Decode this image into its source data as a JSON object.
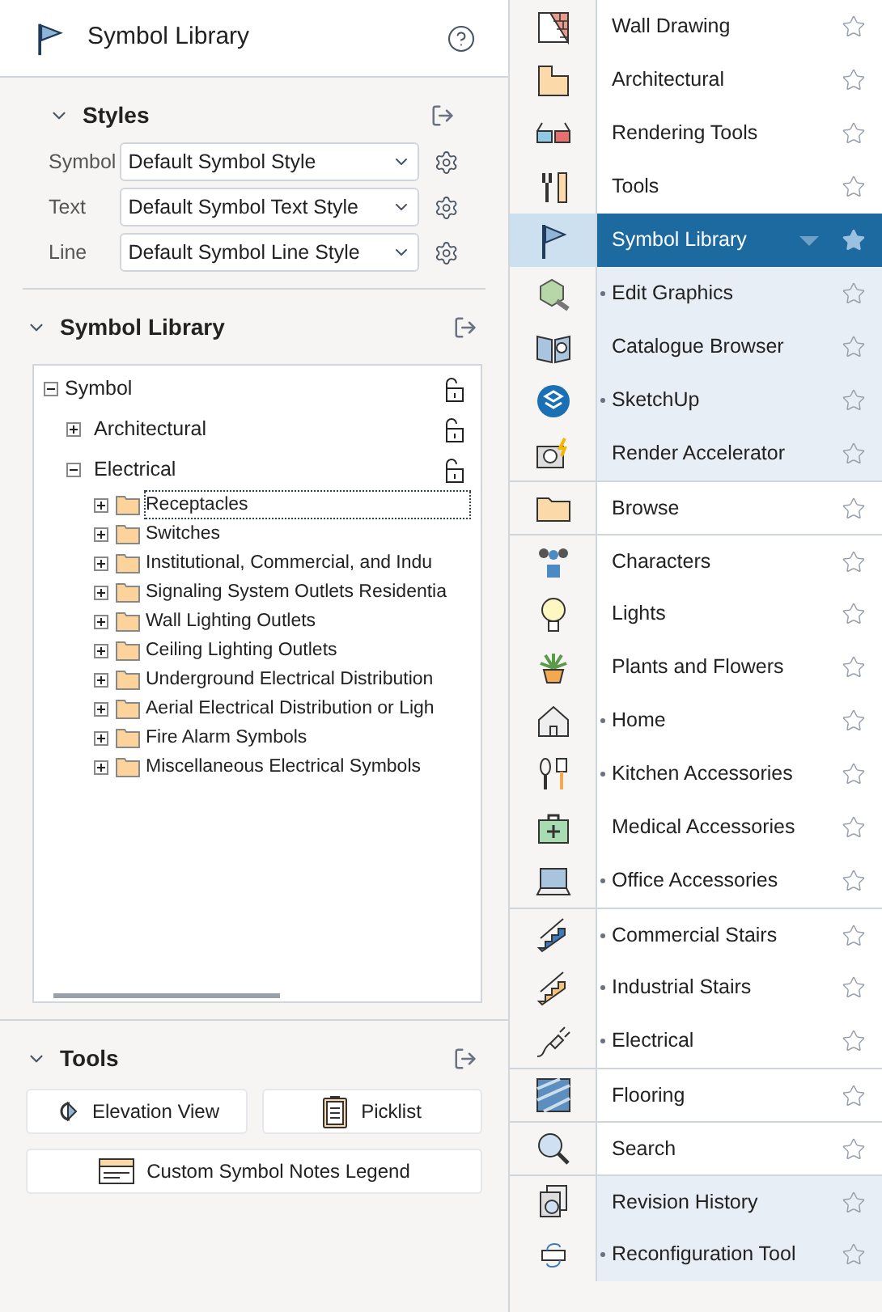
{
  "header": {
    "title": "Symbol Library"
  },
  "styles": {
    "title": "Styles",
    "rows": [
      {
        "label": "Symbol",
        "value": "Default Symbol Style"
      },
      {
        "label": "Text",
        "value": "Default Symbol Text Style"
      },
      {
        "label": "Line",
        "value": "Default Symbol Line Style"
      }
    ]
  },
  "library": {
    "title": "Symbol Library",
    "tree": [
      {
        "label": "Symbol",
        "expanded": true,
        "unlocked": true,
        "children": [
          {
            "label": "Architectural",
            "expanded": false,
            "unlocked": true
          },
          {
            "label": "Electrical",
            "expanded": true,
            "unlocked": true,
            "children": [
              {
                "label": "Receptacles",
                "selected": true
              },
              {
                "label": "Switches",
                "selected": false
              },
              {
                "label": "Institutional, Commercial, and Indu",
                "selected": false
              },
              {
                "label": "Signaling System Outlets Residentia",
                "selected": false
              },
              {
                "label": "Wall Lighting Outlets",
                "selected": false
              },
              {
                "label": "Ceiling Lighting Outlets",
                "selected": false
              },
              {
                "label": "Underground Electrical Distribution",
                "selected": false
              },
              {
                "label": "Aerial Electrical Distribution or Ligh",
                "selected": false
              },
              {
                "label": "Fire Alarm Symbols",
                "selected": false
              },
              {
                "label": "Miscellaneous Electrical Symbols",
                "selected": false
              }
            ]
          }
        ]
      }
    ]
  },
  "tools": {
    "title": "Tools",
    "buttons": [
      "Elevation View",
      "Picklist",
      "Custom Symbol Notes Legend"
    ]
  },
  "menu": [
    {
      "label": "Wall Drawing",
      "selected": false,
      "highlighted": false,
      "dot": false,
      "separator_before": false,
      "starred": false
    },
    {
      "label": "Architectural",
      "selected": false,
      "highlighted": false,
      "dot": false,
      "separator_before": false,
      "starred": false
    },
    {
      "label": "Rendering Tools",
      "selected": false,
      "highlighted": false,
      "dot": false,
      "separator_before": false,
      "starred": false
    },
    {
      "label": "Tools",
      "selected": false,
      "highlighted": false,
      "dot": false,
      "separator_before": false,
      "starred": false
    },
    {
      "label": "Symbol Library",
      "selected": true,
      "dot": false,
      "separator_before": false,
      "starred": true
    },
    {
      "label": "Edit Graphics",
      "selected": false,
      "highlighted": true,
      "dot": true,
      "separator_before": false,
      "starred": false
    },
    {
      "label": "Catalogue Browser",
      "selected": false,
      "highlighted": true,
      "dot": false,
      "separator_before": false,
      "starred": false
    },
    {
      "label": "SketchUp",
      "selected": false,
      "highlighted": true,
      "dot": true,
      "separator_before": false,
      "starred": false
    },
    {
      "label": "Render Accelerator",
      "selected": false,
      "highlighted": true,
      "dot": false,
      "separator_before": false,
      "starred": false
    },
    {
      "label": "Browse",
      "selected": false,
      "highlighted": false,
      "dot": false,
      "separator_before": true,
      "starred": false
    },
    {
      "label": "Characters",
      "selected": false,
      "highlighted": false,
      "dot": false,
      "separator_before": true,
      "starred": false
    },
    {
      "label": "Lights",
      "selected": false,
      "highlighted": false,
      "dot": false,
      "separator_before": false,
      "starred": false
    },
    {
      "label": "Plants and Flowers",
      "selected": false,
      "highlighted": false,
      "dot": false,
      "separator_before": false,
      "starred": false
    },
    {
      "label": "Home",
      "selected": false,
      "highlighted": false,
      "dot": true,
      "separator_before": false,
      "starred": false
    },
    {
      "label": "Kitchen Accessories",
      "selected": false,
      "highlighted": false,
      "dot": true,
      "separator_before": false,
      "starred": false
    },
    {
      "label": "Medical Accessories",
      "selected": false,
      "highlighted": false,
      "dot": false,
      "separator_before": false,
      "starred": false
    },
    {
      "label": "Office Accessories",
      "selected": false,
      "highlighted": false,
      "dot": true,
      "separator_before": false,
      "starred": false
    },
    {
      "label": "Commercial Stairs",
      "selected": false,
      "highlighted": false,
      "dot": true,
      "separator_before": true,
      "starred": false
    },
    {
      "label": "Industrial Stairs",
      "selected": false,
      "highlighted": false,
      "dot": true,
      "separator_before": false,
      "starred": false
    },
    {
      "label": "Electrical",
      "selected": false,
      "highlighted": false,
      "dot": true,
      "separator_before": false,
      "starred": false
    },
    {
      "label": "Flooring",
      "selected": false,
      "highlighted": false,
      "dot": false,
      "separator_before": true,
      "starred": false
    },
    {
      "label": "Search",
      "selected": false,
      "highlighted": false,
      "dot": false,
      "separator_before": true,
      "starred": false
    },
    {
      "label": "Revision History",
      "selected": false,
      "highlighted": true,
      "dot": false,
      "separator_before": true,
      "starred": false
    },
    {
      "label": "Reconfiguration Tool",
      "selected": false,
      "highlighted": true,
      "dot": true,
      "separator_before": false,
      "starred": false
    }
  ]
}
